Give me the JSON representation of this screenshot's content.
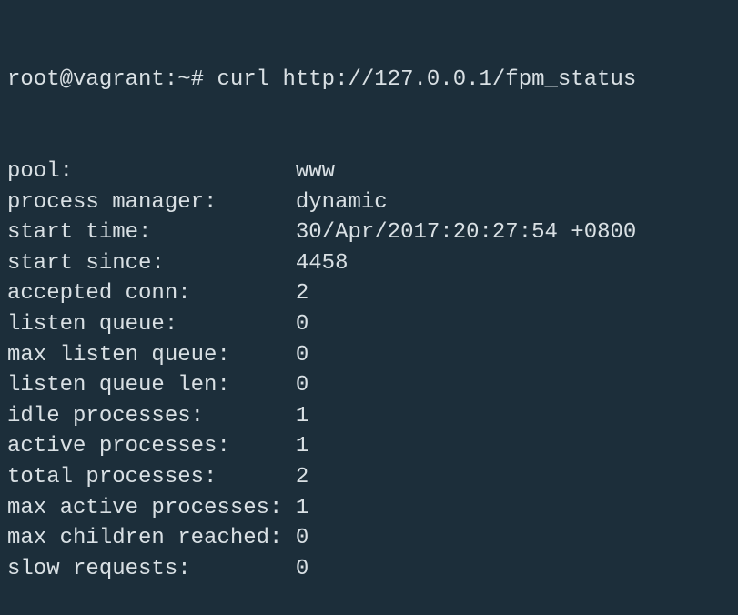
{
  "prompt": {
    "user_host": "root@vagrant",
    "path": "~",
    "symbol": "#",
    "command": "curl http://127.0.0.1/fpm_status"
  },
  "status": {
    "rows": [
      {
        "label": "pool:",
        "value": "www"
      },
      {
        "label": "process manager:",
        "value": "dynamic"
      },
      {
        "label": "start time:",
        "value": "30/Apr/2017:20:27:54 +0800"
      },
      {
        "label": "start since:",
        "value": "4458"
      },
      {
        "label": "accepted conn:",
        "value": "2"
      },
      {
        "label": "listen queue:",
        "value": "0"
      },
      {
        "label": "max listen queue:",
        "value": "0"
      },
      {
        "label": "listen queue len:",
        "value": "0"
      },
      {
        "label": "idle processes:",
        "value": "1"
      },
      {
        "label": "active processes:",
        "value": "1"
      },
      {
        "label": "total processes:",
        "value": "2"
      },
      {
        "label": "max active processes:",
        "value": "1"
      },
      {
        "label": "max children reached:",
        "value": "0"
      },
      {
        "label": "slow requests:",
        "value": "0"
      }
    ]
  }
}
